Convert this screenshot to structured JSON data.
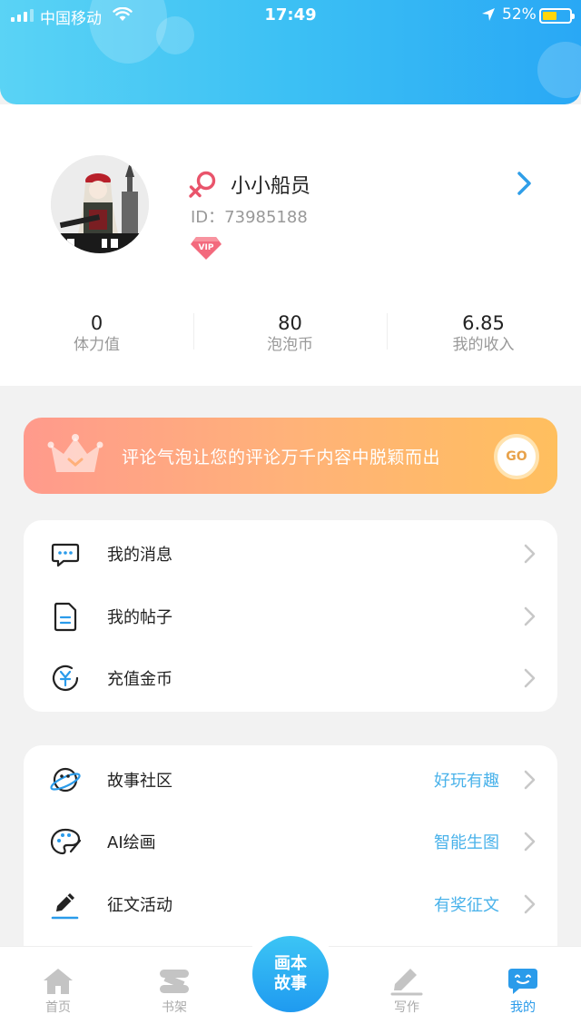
{
  "status_bar": {
    "carrier": "中国移动",
    "time": "17:49",
    "battery": "52%"
  },
  "profile": {
    "username": "小小船员",
    "user_id": "ID：73985188",
    "badge": "VIP"
  },
  "stats": [
    {
      "value": "0",
      "label": "体力值"
    },
    {
      "value": "80",
      "label": "泡泡币"
    },
    {
      "value": "6.85",
      "label": "我的收入"
    }
  ],
  "banner": {
    "text": "评论气泡让您的评论万千内容中脱颖而出",
    "go_label": "GO"
  },
  "menu_group_1": [
    {
      "label": "我的消息",
      "icon": "message-icon"
    },
    {
      "label": "我的帖子",
      "icon": "document-icon"
    },
    {
      "label": "充值金币",
      "icon": "yuan-coin-icon"
    }
  ],
  "menu_group_2": [
    {
      "label": "故事社区",
      "hint": "好玩有趣",
      "icon": "planet-icon"
    },
    {
      "label": "AI绘画",
      "hint": "智能生图",
      "icon": "palette-icon"
    },
    {
      "label": "征文活动",
      "hint": "有奖征文",
      "icon": "pen-icon"
    }
  ],
  "tabbar": {
    "home": "首页",
    "bookshelf": "书架",
    "center_line1": "画本",
    "center_line2": "故事",
    "write": "写作",
    "mine": "我的"
  },
  "colors": {
    "accent_blue": "#2a9bea",
    "hint_blue": "#49b2ea",
    "banner_start": "#ff9a8c",
    "banner_end": "#ffbf5e",
    "gender_red": "#e9546b"
  }
}
